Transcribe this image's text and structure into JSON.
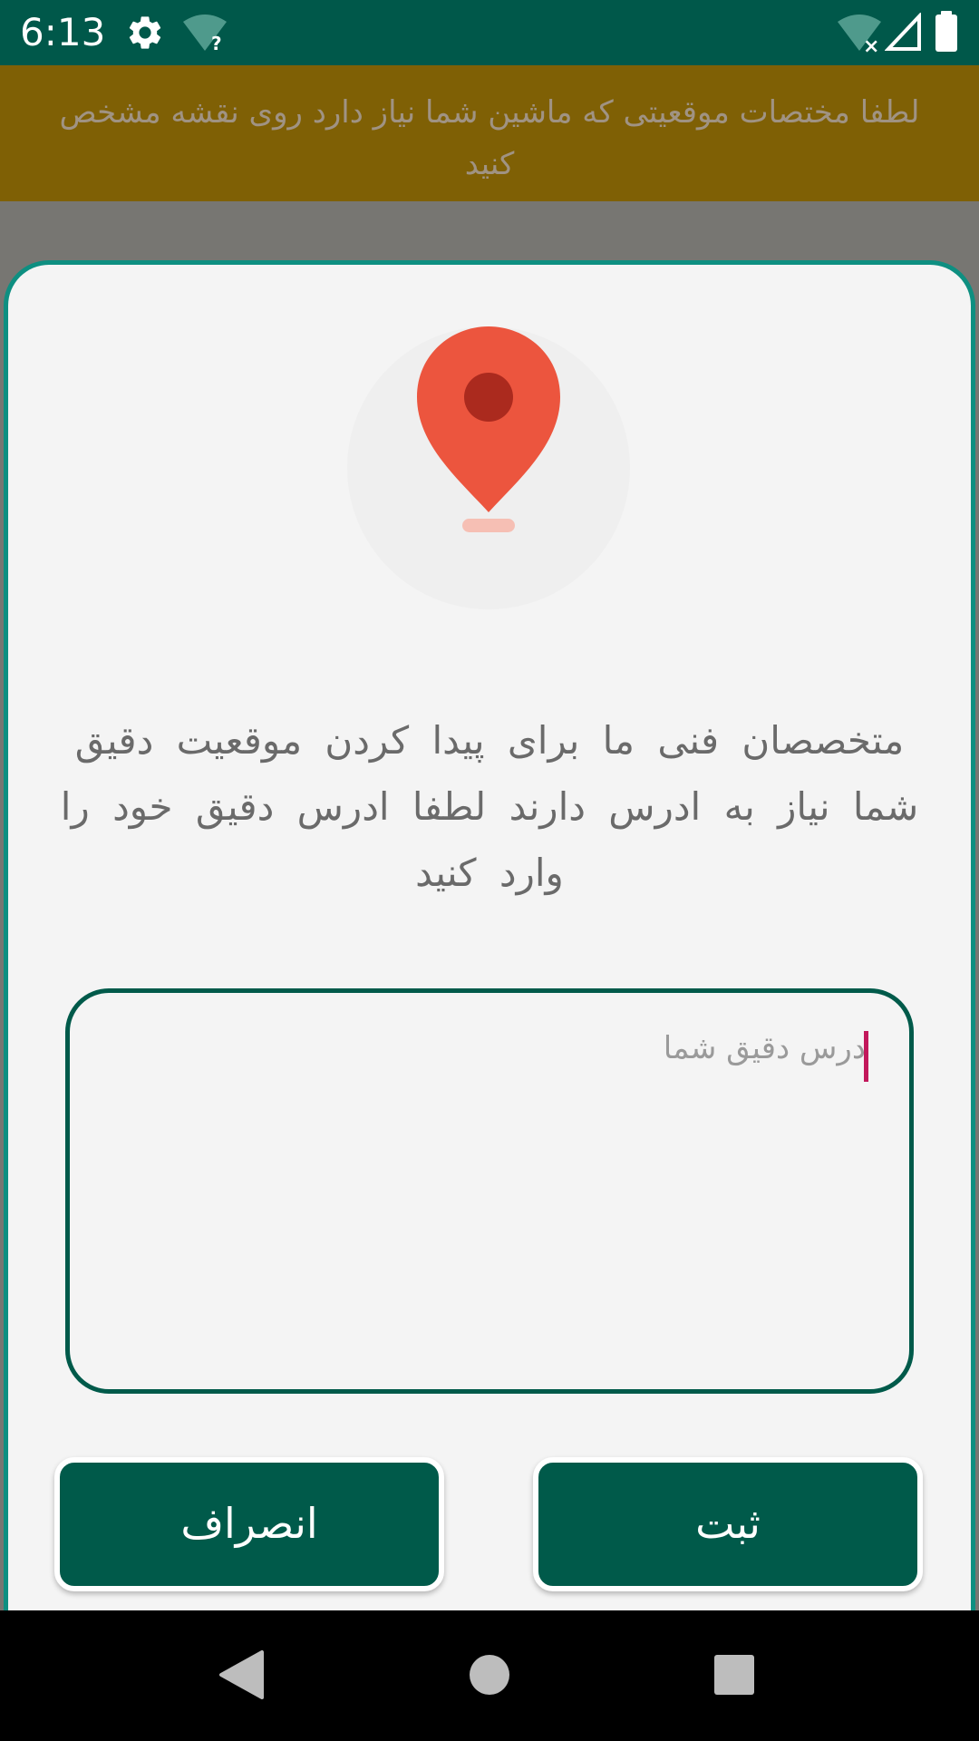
{
  "status_bar": {
    "time": "6:13",
    "icons": [
      "gear-icon",
      "wifi-question-icon",
      "wifi-off-icon",
      "signal-icon",
      "battery-icon"
    ]
  },
  "banner": {
    "text": "لطفا مختصات موقعیتی که ماشین شما نیاز دارد روی نقشه مشخص کنید",
    "background": "#7f6005"
  },
  "dialog": {
    "icon": "location-pin-icon",
    "message": "متخصصان فنی ما برای پیدا کردن موقعیت دقیق شما نیاز به ادرس دارند لطفا ادرس دقیق خود را وارد کنید",
    "address_input": {
      "value": "",
      "placeholder": "درس دقیق شما"
    },
    "submit_label": "ثبت",
    "cancel_label": "انصراف",
    "accent_color": "#005a4a"
  },
  "nav_bar": {
    "icons": [
      "back-icon",
      "home-icon",
      "recents-icon"
    ]
  }
}
